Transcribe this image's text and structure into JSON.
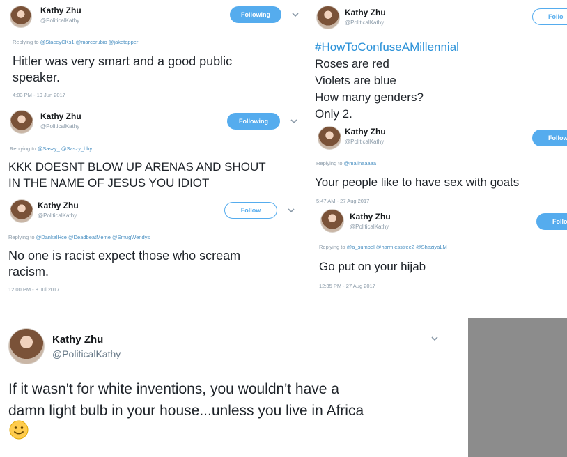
{
  "colors": {
    "accent": "#55acee",
    "hashtag": "#2a91d8",
    "gray_block": "#8c8c8c"
  },
  "icons": [
    "avatar",
    "chevron-down-icon",
    "smiley-emoji-icon"
  ],
  "tweets": [
    {
      "name": "Kathy Zhu",
      "handle": "@PoliticalKathy",
      "button": "Following",
      "reply_prefix": "Replying to ",
      "reply_mentions": "@StaceyCKs1 @marcorubio @jaketapper",
      "lines": [
        "Hitler was very smart and a good public",
        "speaker."
      ],
      "time": "4:03 PM - 19 Jun 2017"
    },
    {
      "name": "Kathy Zhu",
      "handle": "@PoliticalKathy",
      "button": "Following",
      "reply_prefix": "Replying to ",
      "reply_mentions": "@Saszy_ @Saszy_bby",
      "lines": [
        "KKK DOESNT BLOW UP ARENAS AND SHOUT",
        "IN THE NAME OF JESUS YOU IDIOT"
      ]
    },
    {
      "name": "Kathy Zhu",
      "handle": "@PoliticalKathy",
      "button": "Follow",
      "reply_prefix": "Replying to ",
      "reply_mentions": "@DankalHce @DeadbeatMeme @SmugWendys",
      "lines": [
        "No one is racist expect those who scream",
        "racism."
      ],
      "time": "12:00 PM - 8 Jul 2017"
    },
    {
      "name": "Kathy Zhu",
      "handle": "@PoliticalKathy",
      "button": "Follo",
      "lines": [
        "#HowToConfuseAMillennial",
        "Roses are red",
        "Violets are blue",
        "How many genders?",
        "Only 2."
      ]
    },
    {
      "name": "Kathy Zhu",
      "handle": "@PoliticalKathy",
      "button": "Follow",
      "reply_prefix": "Replying to ",
      "reply_mentions": "@maiinaaaaa",
      "lines": [
        "Your people like to have sex with goats"
      ],
      "time": "5:47 AM - 27 Aug 2017"
    },
    {
      "name": "Kathy Zhu",
      "handle": "@PoliticalKathy",
      "button": "Follo",
      "reply_prefix": "Replying to ",
      "reply_mentions": "@a_sumbel @harmlesstree2 @ShaziyaLM",
      "lines": [
        "Go put on your hijab"
      ],
      "time": "12:35 PM - 27 Aug 2017"
    },
    {
      "name": "Kathy Zhu",
      "handle": "@PoliticalKathy",
      "lines": [
        "If it wasn't for white inventions, you wouldn't have a",
        "damn light bulb in your house...unless you live in Africa"
      ]
    }
  ]
}
